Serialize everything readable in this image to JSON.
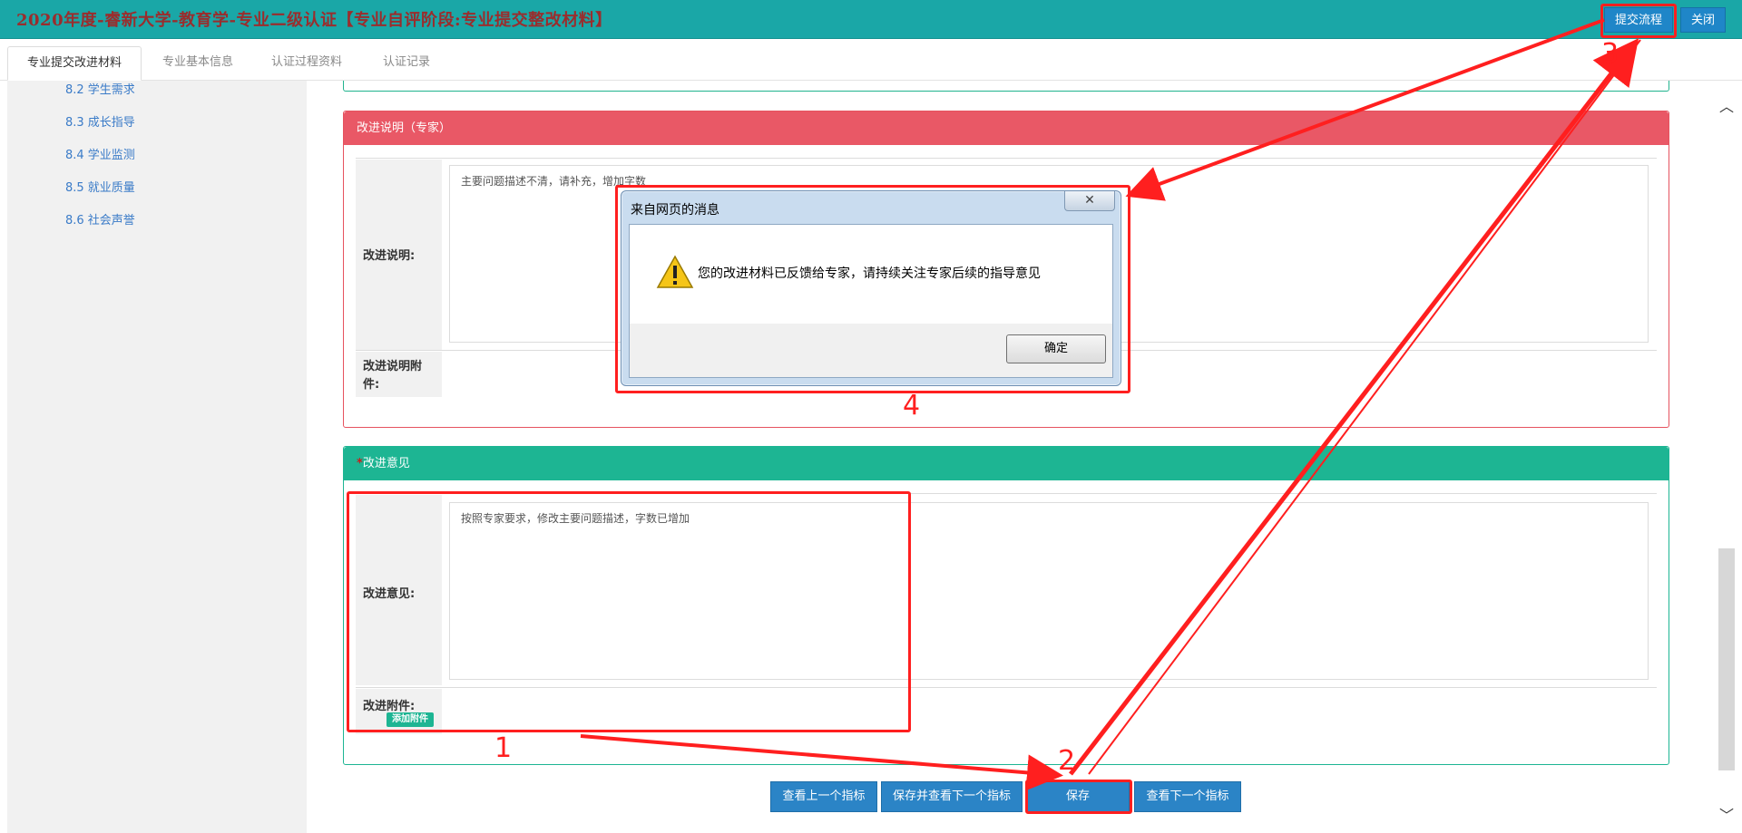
{
  "header": {
    "title": "2020年度-睿新大学-教育学-专业二级认证【专业自评阶段:专业提交整改材料】",
    "submit_flow_label": "提交流程",
    "close_label": "关闭"
  },
  "tabs": [
    {
      "label": "专业提交改进材料",
      "active": true
    },
    {
      "label": "专业基本信息",
      "active": false
    },
    {
      "label": "认证过程资料",
      "active": false
    },
    {
      "label": "认证记录",
      "active": false
    }
  ],
  "sidebar": {
    "items": [
      {
        "label": "8.2 学生需求"
      },
      {
        "label": "8.3 成长指导"
      },
      {
        "label": "8.4 学业监测"
      },
      {
        "label": "8.5 就业质量"
      },
      {
        "label": "8.6 社会声誉"
      }
    ]
  },
  "expert_panel": {
    "title": "改进说明（专家）",
    "desc_label": "改进说明:",
    "desc_value": "主要问题描述不清，请补充，增加字数",
    "attach_label": "改进说明附件:"
  },
  "opinion_panel": {
    "required_mark": "*",
    "title": "改进意见",
    "opinion_label": "改进意见:",
    "opinion_value": "按照专家要求，修改主要问题描述，字数已增加",
    "attach_label": "改进附件:",
    "add_attach_label": "添加附件"
  },
  "buttons": {
    "prev": "查看上一个指标",
    "save_next": "保存并查看下一个指标",
    "save": "保存",
    "next": "查看下一个指标"
  },
  "dialog": {
    "title": "来自网页的消息",
    "message": "您的改进材料已反馈给专家，请持续关注专家后续的指导意见",
    "ok_label": "确定",
    "close_glyph": "✕",
    "icon": "warning-icon"
  },
  "annotations": {
    "n1": "1",
    "n2": "2",
    "n3": "3",
    "n4": "4",
    "color": "#ff1f1f"
  },
  "scroll_arrows": {
    "up": "︿",
    "down": "﹀"
  }
}
